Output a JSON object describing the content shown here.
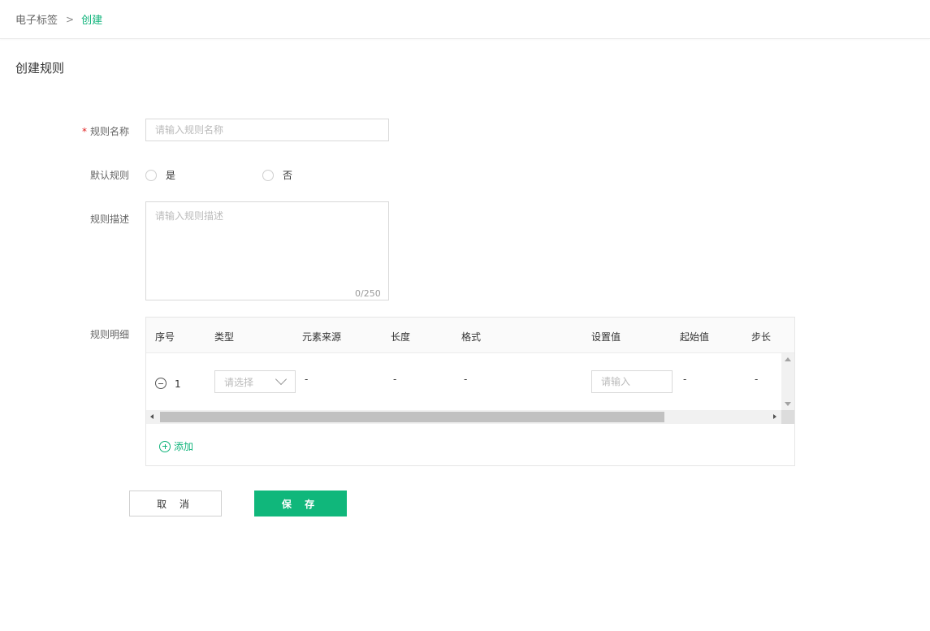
{
  "breadcrumb": {
    "root": "电子标签",
    "separator": ">",
    "current": "创建"
  },
  "page": {
    "title": "创建规则"
  },
  "form": {
    "name": {
      "label": "规则名称",
      "required_mark": "*",
      "placeholder": "请输入规则名称",
      "value": ""
    },
    "default_rule": {
      "label": "默认规则",
      "options": [
        "是",
        "否"
      ],
      "selected": null
    },
    "description": {
      "label": "规则描述",
      "placeholder": "请输入规则描述",
      "value": "",
      "counter": "0/250"
    },
    "detail": {
      "label": "规则明细",
      "columns": [
        "序号",
        "类型",
        "元素来源",
        "长度",
        "格式",
        "设置值",
        "起始值",
        "步长"
      ],
      "rows": [
        {
          "index": "1",
          "type_placeholder": "请选择",
          "source": "-",
          "length": "-",
          "format": "-",
          "value_placeholder": "请输入",
          "start": "-",
          "step": "-"
        }
      ],
      "add_label": "添加"
    }
  },
  "actions": {
    "cancel": "取 消",
    "save": "保 存"
  },
  "colors": {
    "accent": "#0fb37a",
    "required": "#e02020"
  }
}
